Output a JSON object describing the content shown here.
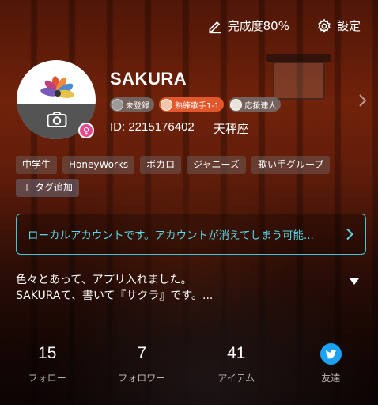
{
  "header": {
    "completion_label": "完成度80%",
    "settings_label": "設定"
  },
  "profile": {
    "username": "SAKURA",
    "badges": [
      {
        "label": "未登録",
        "icon": "shield-icon"
      },
      {
        "label": "熟練歌手1-1",
        "icon": "singer-avatar-icon"
      },
      {
        "label": "応援達人",
        "icon": "cheer-avatar-icon"
      }
    ],
    "id_text": "ID: 2215176402",
    "zodiac": "天秤座",
    "gender": "female"
  },
  "tags": [
    "中学生",
    "HoneyWorks",
    "ボカロ",
    "ジャニーズ",
    "歌い手グループ"
  ],
  "add_tag_label": "タグ追加",
  "notice": {
    "text": "ローカルアカウントです。アカウントが消えてしまう可能...",
    "color": "#3fc6d4"
  },
  "bio": {
    "line1": "色々とあって、アプリ入れました。",
    "line2": "SAKURAて、書いて『サクラ』です。..."
  },
  "stats": [
    {
      "value": "15",
      "label": "フォロー"
    },
    {
      "value": "7",
      "label": "フォロワー"
    },
    {
      "value": "41",
      "label": "アイテム"
    },
    {
      "value": "",
      "label": "友達",
      "icon": "twitter-icon"
    }
  ],
  "colors": {
    "accent_cyan": "#3fc6d4",
    "badge_orange": "#e2572b",
    "gender_pink": "#e8488c",
    "twitter_blue": "#1da1f2"
  }
}
